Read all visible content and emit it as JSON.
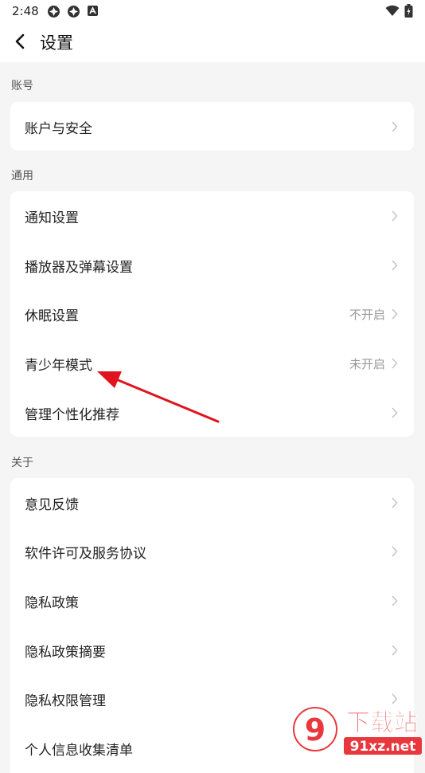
{
  "status_bar": {
    "time": "2:48",
    "left_icons": [
      "app-notification-icon",
      "app-notification-icon",
      "accessibility-icon"
    ],
    "right_icons": [
      "wifi-icon",
      "battery-icon"
    ]
  },
  "header": {
    "back_icon": "back-arrow-icon",
    "title": "设置"
  },
  "sections": [
    {
      "label": "账号",
      "items": [
        {
          "label": "账户与安全",
          "value": ""
        }
      ]
    },
    {
      "label": "通用",
      "items": [
        {
          "label": "通知设置",
          "value": ""
        },
        {
          "label": "播放器及弹幕设置",
          "value": ""
        },
        {
          "label": "休眠设置",
          "value": "不开启"
        },
        {
          "label": "青少年模式",
          "value": "未开启"
        },
        {
          "label": "管理个性化推荐",
          "value": ""
        }
      ]
    },
    {
      "label": "关于",
      "items": [
        {
          "label": "意见反馈",
          "value": ""
        },
        {
          "label": "软件许可及服务协议",
          "value": ""
        },
        {
          "label": "隐私政策",
          "value": ""
        },
        {
          "label": "隐私政策摘要",
          "value": ""
        },
        {
          "label": "隐私权限管理",
          "value": ""
        },
        {
          "label": "个人信息收集清单",
          "value": ""
        }
      ]
    }
  ],
  "annotation": {
    "color": "#e0141e",
    "points_to": "青少年模式"
  },
  "watermark": {
    "text_top": "下载站",
    "text_bottom": "91xz.net",
    "logo_color": "#e8383d"
  }
}
